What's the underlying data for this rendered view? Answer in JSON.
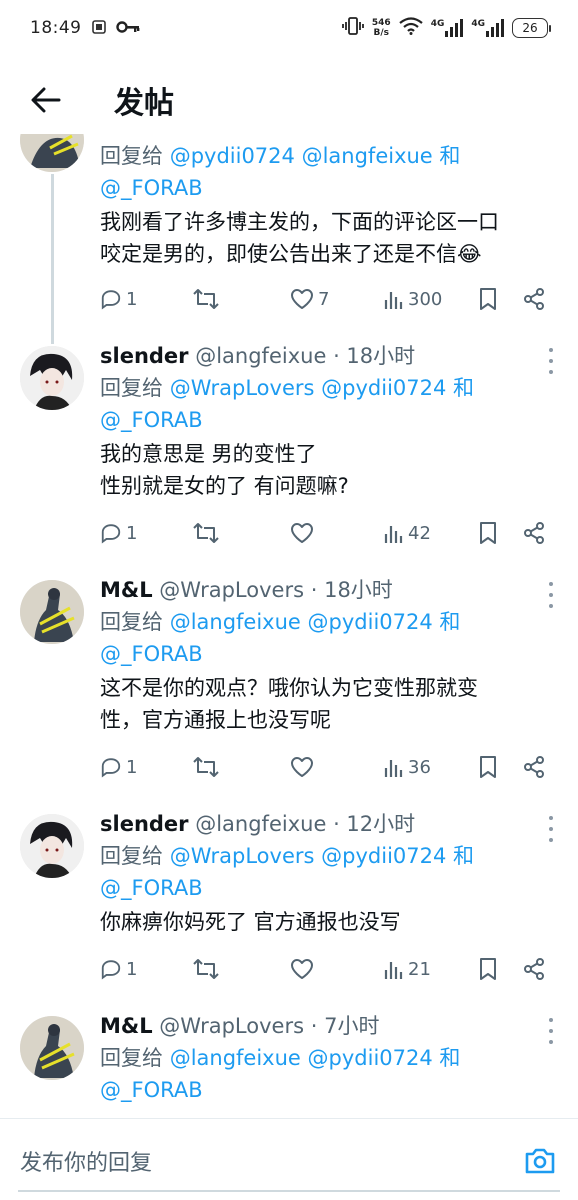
{
  "status_bar": {
    "time": "18:49",
    "net_speed_value": "546",
    "net_speed_unit": "B/s",
    "signal_1": "4G",
    "signal_2": "4G",
    "battery": "26"
  },
  "header": {
    "title": "发帖"
  },
  "tweets": [
    {
      "reply_prefix": "回复给 ",
      "mentions": [
        "@pydii0724",
        "@langfeixue",
        "@_FORAB"
      ],
      "joiner": " 和",
      "text_lines": [
        "我刚看了许多博主发的，下面的评论区一口",
        "咬定是男的，即使公告出来了还是不信😂"
      ],
      "replies": "1",
      "retweets": "",
      "likes": "7",
      "views": "300"
    },
    {
      "name": "slender",
      "handle": "@langfeixue",
      "time": "· 18小时",
      "reply_prefix": "回复给 ",
      "mentions": [
        "@WrapLovers",
        "@pydii0724",
        "@_FORAB"
      ],
      "joiner": " 和",
      "text_lines": [
        "我的意思是 男的变性了",
        "性别就是女的了 有问题嘛?"
      ],
      "replies": "1",
      "retweets": "",
      "likes": "",
      "views": "42"
    },
    {
      "name": "M&L",
      "handle": "@WrapLovers",
      "time": "· 18小时",
      "reply_prefix": "回复给 ",
      "mentions": [
        "@langfeixue",
        "@pydii0724",
        "@_FORAB"
      ],
      "joiner": " 和",
      "text_lines": [
        "这不是你的观点？哦你认为它变性那就变",
        "性，官方通报上也没写呢"
      ],
      "replies": "1",
      "retweets": "",
      "likes": "",
      "views": "36"
    },
    {
      "name": "slender",
      "handle": "@langfeixue",
      "time": "· 12小时",
      "reply_prefix": "回复给 ",
      "mentions": [
        "@WrapLovers",
        "@pydii0724",
        "@_FORAB"
      ],
      "joiner": " 和",
      "text_lines": [
        "你麻痹你妈死了 官方通报也没写"
      ],
      "replies": "1",
      "retweets": "",
      "likes": "",
      "views": "21"
    },
    {
      "name": "M&L",
      "handle": "@WrapLovers",
      "time": "· 7小时",
      "reply_prefix": "回复给 ",
      "mentions": [
        "@langfeixue",
        "@pydii0724",
        "@_FORAB"
      ],
      "joiner": " 和",
      "text_lines": []
    }
  ],
  "composer": {
    "placeholder": "发布你的回复"
  },
  "icons": {
    "back": "arrow-left-icon",
    "reply": "speech-bubble-icon",
    "retweet": "retweet-icon",
    "like": "heart-icon",
    "views": "bar-chart-icon",
    "bookmark": "bookmark-icon",
    "share": "share-icon",
    "camera": "camera-icon",
    "more": "more-vertical-icon"
  },
  "colors": {
    "accent": "#1d9bf0",
    "secondary_text": "#536471",
    "primary_text": "#0f1419"
  }
}
